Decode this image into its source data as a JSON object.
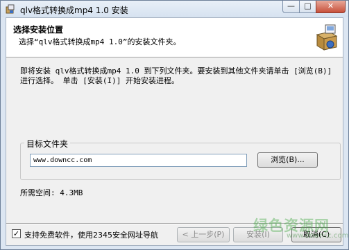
{
  "window": {
    "title": "qlv格式转换成mp4 1.0 安装"
  },
  "title_buttons": {
    "minimize": "—",
    "maximize": "□",
    "close": "✕"
  },
  "header": {
    "title": "选择安装位置",
    "subtitle": "选择“qlv格式转换成mp4 1.0”的安装文件夹。",
    "icon": "installer-box-icon"
  },
  "body": {
    "description": "即将安装 qlv格式转换成mp4 1.0 到下列文件夹。要安装到其他文件夹请单击 [浏览(B)] 进行选择。 单击 [安装(I)] 开始安装进程。",
    "target_group_label": "目标文件夹",
    "install_path": "www.downcc.com",
    "browse_label": "浏览(B)...",
    "space_required": "所需空间: 4.3MB"
  },
  "footer": {
    "checkbox_checked": true,
    "checkbox_label": "支持免费软件，使用2345安全网址导航",
    "back_label": "< 上一步(P)",
    "install_label": "安装(I)",
    "cancel_label": "取消(C)"
  },
  "watermark": {
    "text": "绿色资源网",
    "url": "www.downcc.com"
  }
}
